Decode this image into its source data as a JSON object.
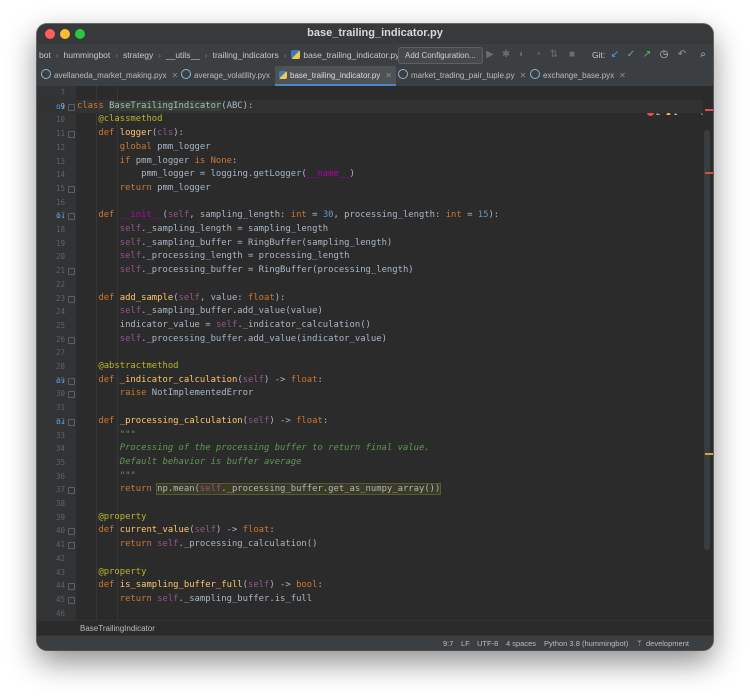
{
  "window": {
    "title": "base_trailing_indicator.py"
  },
  "navbar": {
    "breadcrumbs": [
      "bot",
      "hummingbot",
      "strategy",
      "__utils__",
      "trailing_indicators",
      "base_trailing_indicator.py"
    ],
    "add_configuration": "Add Configuration...",
    "git_label": "Git:"
  },
  "tabs": [
    {
      "label": "avellaneda_market_making.pyx",
      "icon": "cython-file-icon"
    },
    {
      "label": "average_volatility.pyx",
      "icon": "cython-file-icon"
    },
    {
      "label": "base_trailing_indicator.py",
      "icon": "python-file-icon",
      "active": true
    },
    {
      "label": "market_trading_pair_tuple.py",
      "icon": "cython-file-icon"
    },
    {
      "label": "exchange_base.pyx",
      "icon": "cython-file-icon"
    }
  ],
  "inspection": {
    "errors": "2",
    "warnings": "1"
  },
  "code_lines": [
    {
      "n": "7",
      "text": ""
    },
    {
      "n": "9",
      "text": "class BaseTrailingIndicator(ABC):"
    },
    {
      "n": "10",
      "text": "    @classmethod"
    },
    {
      "n": "11",
      "text": "    def logger(cls):"
    },
    {
      "n": "12",
      "text": "        global pmm_logger"
    },
    {
      "n": "13",
      "text": "        if pmm_logger is None:"
    },
    {
      "n": "14",
      "text": "            pmm_logger = logging.getLogger(__name__)"
    },
    {
      "n": "15",
      "text": "        return pmm_logger"
    },
    {
      "n": "16",
      "text": ""
    },
    {
      "n": "17",
      "text": "    def __init__(self, sampling_length: int = 30, processing_length: int = 15):"
    },
    {
      "n": "18",
      "text": "        self._sampling_length = sampling_length"
    },
    {
      "n": "19",
      "text": "        self._sampling_buffer = RingBuffer(sampling_length)"
    },
    {
      "n": "20",
      "text": "        self._processing_length = processing_length"
    },
    {
      "n": "21",
      "text": "        self._processing_buffer = RingBuffer(processing_length)"
    },
    {
      "n": "22",
      "text": ""
    },
    {
      "n": "23",
      "text": "    def add_sample(self, value: float):"
    },
    {
      "n": "24",
      "text": "        self._sampling_buffer.add_value(value)"
    },
    {
      "n": "25",
      "text": "        indicator_value = self._indicator_calculation()"
    },
    {
      "n": "26",
      "text": "        self._processing_buffer.add_value(indicator_value)"
    },
    {
      "n": "27",
      "text": ""
    },
    {
      "n": "28",
      "text": "    @abstractmethod"
    },
    {
      "n": "29",
      "text": "    def _indicator_calculation(self) -> float:"
    },
    {
      "n": "30",
      "text": "        raise NotImplementedError"
    },
    {
      "n": "31",
      "text": ""
    },
    {
      "n": "32",
      "text": "    def _processing_calculation(self) -> float:"
    },
    {
      "n": "33",
      "text": "        \"\"\""
    },
    {
      "n": "34",
      "text": "        Processing of the processing buffer to return final value."
    },
    {
      "n": "35",
      "text": "        Default behavior is buffer average"
    },
    {
      "n": "36",
      "text": "        \"\"\""
    },
    {
      "n": "37",
      "text": "        return np.mean(self._processing_buffer.get_as_numpy_array())"
    },
    {
      "n": "38",
      "text": ""
    },
    {
      "n": "39",
      "text": "    @property"
    },
    {
      "n": "40",
      "text": "    def current_value(self) -> float:"
    },
    {
      "n": "41",
      "text": "        return self._processing_calculation()"
    },
    {
      "n": "42",
      "text": ""
    },
    {
      "n": "43",
      "text": "    @property"
    },
    {
      "n": "44",
      "text": "    def is_sampling_buffer_full(self) -> bool:"
    },
    {
      "n": "45",
      "text": "        return self._sampling_buffer.is_full"
    },
    {
      "n": "46",
      "text": ""
    }
  ],
  "breadcrumb": {
    "label": "BaseTrailingIndicator"
  },
  "statusbar": {
    "position": "9:7",
    "line_ending": "LF",
    "encoding": "UTF-8",
    "indent": "4 spaces",
    "interpreter": "Python 3.8 (hummingbot)",
    "branch": "development"
  }
}
